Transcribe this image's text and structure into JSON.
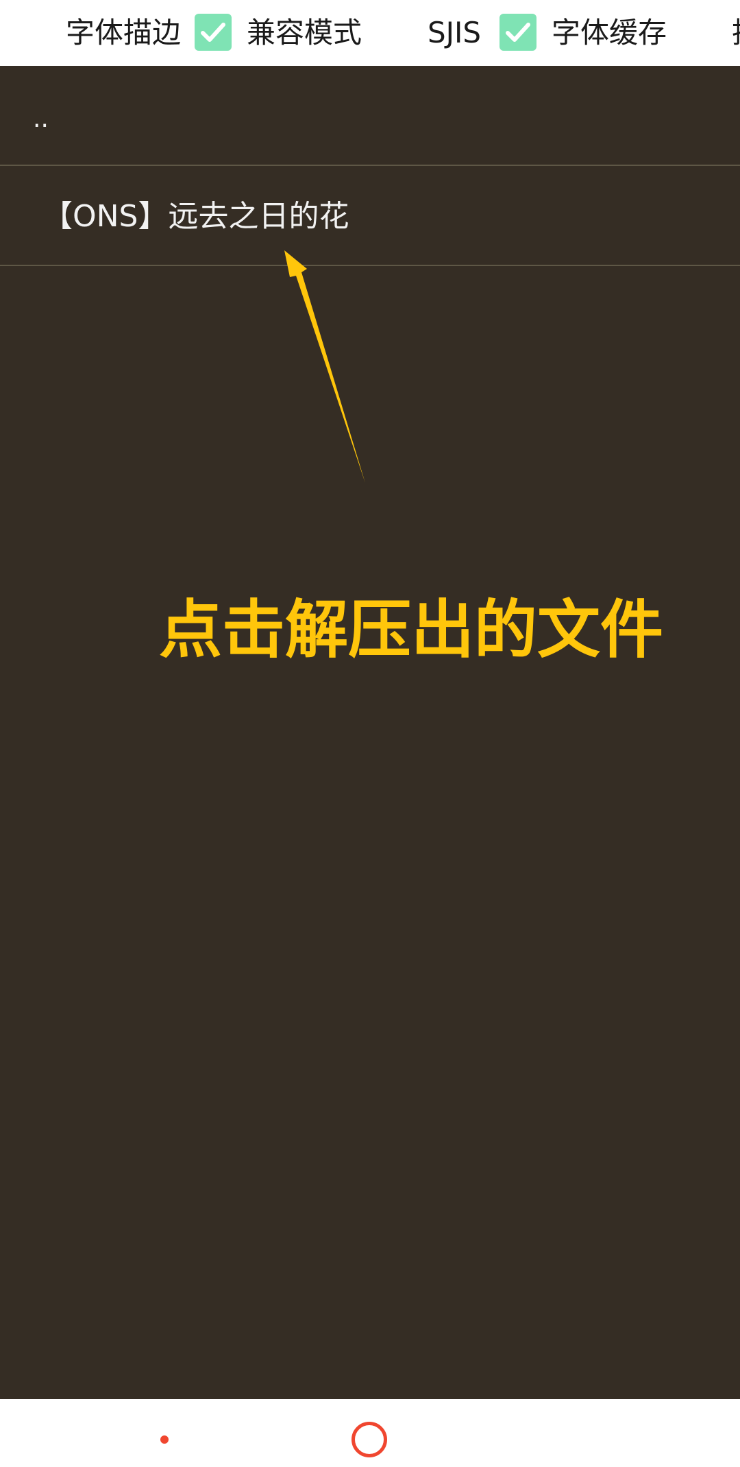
{
  "options": {
    "font_outline": "字体描边",
    "compat_mode": "兼容模式",
    "compat_checked": true,
    "sjis": "SJIS",
    "sjis_checked": true,
    "font_cache": "字体缓存",
    "cut_off": "抖"
  },
  "file_list": {
    "parent": "..",
    "items": [
      "【ONS】远去之日的花"
    ]
  },
  "annotation": {
    "text": "点击解压出的文件",
    "color": "#ffc60b"
  },
  "colors": {
    "panel_bg": "#352d24",
    "checkbox": "#7fe3b4",
    "nav_accent": "#f0462f"
  }
}
